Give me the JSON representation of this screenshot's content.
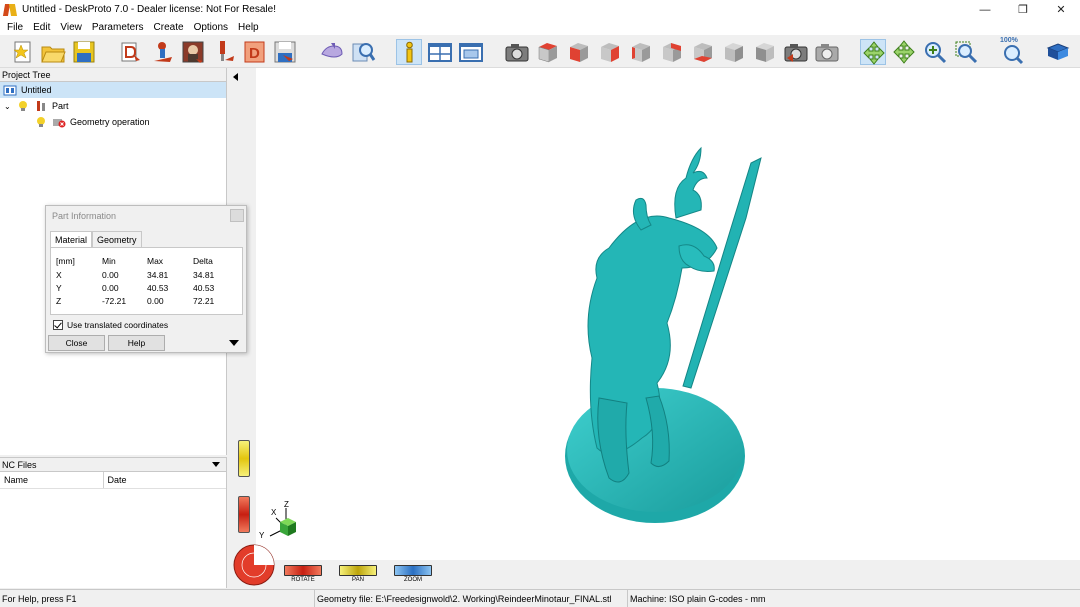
{
  "window": {
    "title": "Untitled - DeskProto 7.0 - Dealer license: Not For Resale!",
    "minimize_glyph": "—",
    "restore_glyph": "❐",
    "close_glyph": "✕"
  },
  "menu": [
    "File",
    "Edit",
    "View",
    "Parameters",
    "Create",
    "Options",
    "Help"
  ],
  "toolbar": {
    "zoom_label": "100%",
    "buttons": [
      "new-project-icon",
      "open-icon",
      "save-icon",
      "import-geometry-icon",
      "part-icon",
      "image-icon",
      "tool-icon",
      "drawing-icon",
      "save-nc-icon",
      "simulate-icon",
      "preview-icon",
      "info-icon",
      "window-layout-icon",
      "screen-icon",
      "camera-icon",
      "view-top-icon",
      "view-front-icon",
      "view-right-icon",
      "view-left-icon",
      "view-back-icon",
      "view-bottom-icon",
      "view-iso-icon",
      "view-iso2-icon",
      "camera-prev-icon",
      "camera-next-icon",
      "rotate-icon",
      "pan-icon",
      "zoom-in-icon",
      "zoom-window-icon",
      "zoom-100-icon",
      "help-book-icon"
    ]
  },
  "project_tree": {
    "header": "Project Tree",
    "root": "Untitled",
    "part": "Part",
    "operation": "Geometry operation"
  },
  "part_info": {
    "title": "Part Information",
    "tabs": [
      "Material",
      "Geometry"
    ],
    "columns": [
      "[mm]",
      "Min",
      "Max",
      "Delta"
    ],
    "rows": [
      {
        "axis": "X",
        "min": "0.00",
        "max": "34.81",
        "delta": "34.81"
      },
      {
        "axis": "Y",
        "min": "0.00",
        "max": "40.53",
        "delta": "40.53"
      },
      {
        "axis": "Z",
        "min": "-72.21",
        "max": "0.00",
        "delta": "72.21"
      }
    ],
    "checkbox_label": "Use translated coordinates",
    "close_label": "Close",
    "help_label": "Help"
  },
  "nc_files": {
    "header": "NC Files",
    "col_name": "Name",
    "col_date": "Date"
  },
  "viewport": {
    "model_color": "#22b3b3",
    "axis_x": "X",
    "axis_y": "Y",
    "axis_z": "Z",
    "modes": [
      "ROTATE",
      "PAN",
      "ZOOM"
    ]
  },
  "status": {
    "help": "For Help, press F1",
    "geometry": "Geometry file: E:\\Freedesignwold\\2. Working\\ReindeerMinotaur_FINAL.stl",
    "machine": "Machine: ISO plain G-codes - mm"
  }
}
